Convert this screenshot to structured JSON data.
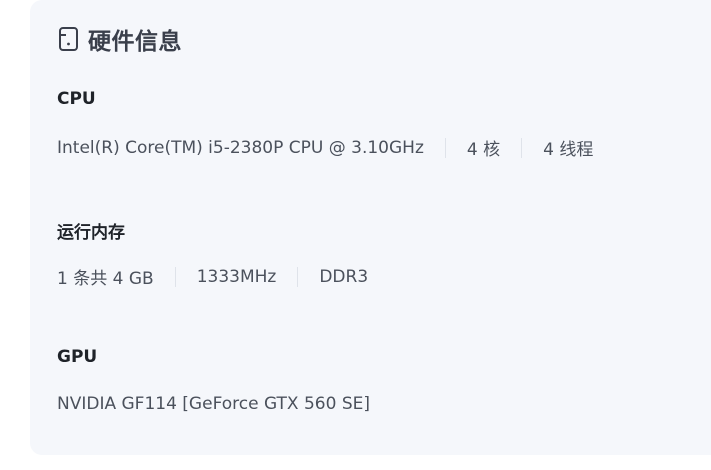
{
  "header": {
    "icon": "device-icon",
    "title": "硬件信息"
  },
  "cpu": {
    "title": "CPU",
    "model": "Intel(R) Core(TM) i5-2380P CPU @ 3.10GHz",
    "cores": "4 核",
    "threads": "4 线程"
  },
  "memory": {
    "title": "运行内存",
    "modules": "1 条共 4 GB",
    "frequency": "1333MHz",
    "type": "DDR3"
  },
  "gpu": {
    "title": "GPU",
    "model": "NVIDIA GF114 [GeForce GTX 560 SE]"
  }
}
